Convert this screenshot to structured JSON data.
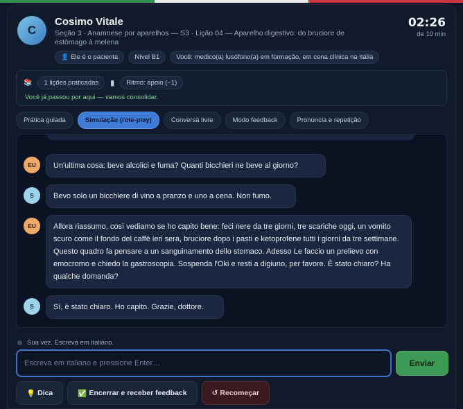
{
  "flag_colors": [
    "#2f8f4e",
    "#e8e8e8",
    "#c9383f"
  ],
  "header": {
    "avatar_initial": "C",
    "name": "Cosimo Vitale",
    "subtitle": "Seção 3 · Anamnese por aparelhos — S3 · Lição 04 — Aparelho digestivo: do bruciore de estômago à melena",
    "timer": "02:26",
    "timer_sub": "de 10 min",
    "chips": [
      {
        "icon": "person-icon",
        "glyph": "👤",
        "label": "Ele é o paciente"
      },
      {
        "icon": "",
        "glyph": "",
        "label": "Nível B1"
      },
      {
        "icon": "",
        "glyph": "",
        "label": "Você: medico(a) lusófono(a) em formação, em cena clínica na Itália"
      }
    ]
  },
  "progress": {
    "lessons": {
      "icon": "books-icon",
      "glyph": "📚",
      "label": "1 lições praticadas"
    },
    "rhythm": {
      "icon": "bar-icon",
      "glyph": "▮",
      "label": "Ritmo: apoio (−1)"
    },
    "note": "Você já passou por aqui — vamos consolidar."
  },
  "tabs": [
    {
      "label": "Prática guiada",
      "active": false
    },
    {
      "label": "Simulação (role-play)",
      "active": true
    },
    {
      "label": "Conversa livre",
      "active": false
    },
    {
      "label": "Modo feedback",
      "active": false
    },
    {
      "label": "Pronúncia e repetição",
      "active": false
    }
  ],
  "messages": [
    {
      "speaker": "EU",
      "text": "Un'ultima cosa: beve alcolici e fuma? Quanti bicchieri ne beve al giorno?"
    },
    {
      "speaker": "S",
      "text": "Bevo solo un bicchiere di vino a pranzo e uno a cena. Non fumo."
    },
    {
      "speaker": "EU",
      "text": "Allora riassumo, così vediamo se ho capito bene: feci nere da tre giorni, tre scariche oggi, un vomito scuro come il fondo del caffè ieri sera, bruciore dopo i pasti e ketoprofene tutti i giorni da tre settimane. Questo quadro fa pensare a un sanguinamento dello stomaco. Adesso Le faccio un prelievo con emocromo e chiedo la gastroscopia. Sospenda l'Oki e resti a digiuno, per favore. È stato chiaro? Ha qualche domanda?"
    },
    {
      "speaker": "S",
      "text": "Sì, è stato chiaro. Ho capito. Grazie, dottore."
    }
  ],
  "status": "Sua vez. Escreva em italiano.",
  "composer": {
    "placeholder": "Escreva em italiano e pressione Enter…",
    "value": "",
    "send_label": "Enviar"
  },
  "actions": {
    "hint": {
      "icon": "lightbulb-icon",
      "glyph": "💡",
      "label": "Dica"
    },
    "finish": {
      "icon": "check-icon",
      "glyph": "✅",
      "label": "Encerrar e receber feedback"
    },
    "restart": {
      "icon": "restart-icon",
      "glyph": "↺",
      "label": "Recomeçar"
    }
  }
}
